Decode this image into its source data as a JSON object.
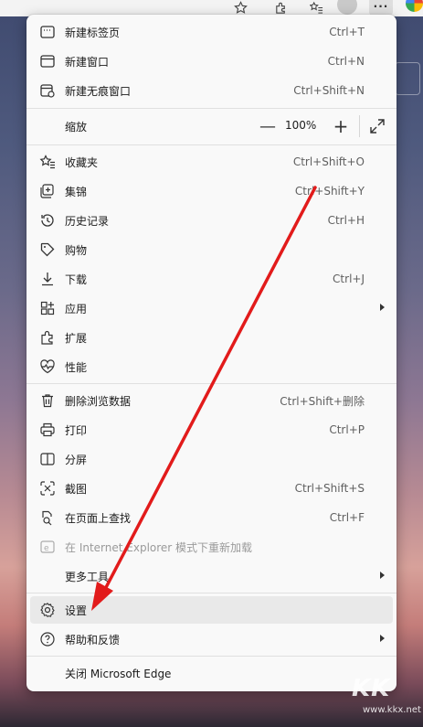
{
  "menu": {
    "items": [
      {
        "label": "新建标签页",
        "shortcut": "Ctrl+T",
        "icon": "new-tab-icon"
      },
      {
        "label": "新建窗口",
        "shortcut": "Ctrl+N",
        "icon": "new-window-icon"
      },
      {
        "label": "新建无痕窗口",
        "shortcut": "Ctrl+Shift+N",
        "icon": "inprivate-window-icon"
      },
      {
        "label": "缩放",
        "icon": "zoom-icon"
      },
      {
        "label": "收藏夹",
        "shortcut": "Ctrl+Shift+O",
        "icon": "favorites-icon"
      },
      {
        "label": "集锦",
        "shortcut": "Ctrl+Shift+Y",
        "icon": "collections-icon"
      },
      {
        "label": "历史记录",
        "shortcut": "Ctrl+H",
        "icon": "history-icon"
      },
      {
        "label": "购物",
        "icon": "shopping-tag-icon"
      },
      {
        "label": "下载",
        "shortcut": "Ctrl+J",
        "icon": "download-icon"
      },
      {
        "label": "应用",
        "icon": "apps-icon"
      },
      {
        "label": "扩展",
        "icon": "extensions-icon"
      },
      {
        "label": "性能",
        "icon": "performance-icon"
      },
      {
        "label": "删除浏览数据",
        "shortcut": "Ctrl+Shift+删除",
        "icon": "trash-icon"
      },
      {
        "label": "打印",
        "shortcut": "Ctrl+P",
        "icon": "print-icon"
      },
      {
        "label": "分屏",
        "icon": "split-screen-icon"
      },
      {
        "label": "截图",
        "shortcut": "Ctrl+Shift+S",
        "icon": "screenshot-icon"
      },
      {
        "label": "在页面上查找",
        "shortcut": "Ctrl+F",
        "icon": "find-on-page-icon"
      },
      {
        "label": "在 Internet Explorer 模式下重新加载",
        "icon": "ie-mode-icon"
      },
      {
        "label": "更多工具",
        "icon": ""
      },
      {
        "label": "设置",
        "icon": "settings-gear-icon"
      },
      {
        "label": "帮助和反馈",
        "icon": "help-icon"
      },
      {
        "label": "关闭 Microsoft Edge",
        "icon": ""
      }
    ],
    "zoom": {
      "minus": "—",
      "value": "100%",
      "plus": "+"
    }
  },
  "watermark": {
    "big": "KK",
    "small": "www.kkx.net"
  },
  "colors": {
    "menu_bg": "#f9f9f9",
    "highlight": "#e9e9e9",
    "arrow": "#e21b1b"
  }
}
